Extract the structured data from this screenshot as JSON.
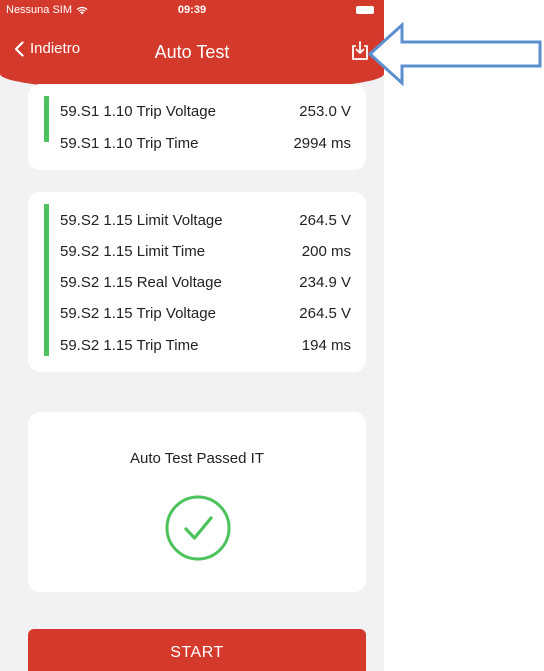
{
  "status_bar": {
    "carrier": "Nessuna SIM",
    "time": "09:39"
  },
  "nav": {
    "back_label": "Indietro",
    "title": "Auto Test"
  },
  "card1": {
    "rows": [
      {
        "label": "59.S1 1.10 Trip Voltage",
        "value": "253.0 V"
      },
      {
        "label": "59.S1 1.10 Trip Time",
        "value": "2994 ms"
      }
    ]
  },
  "card2": {
    "rows": [
      {
        "label": "59.S2 1.15 Limit Voltage",
        "value": "264.5 V"
      },
      {
        "label": "59.S2 1.15 Limit Time",
        "value": "200 ms"
      },
      {
        "label": "59.S2 1.15 Real Voltage",
        "value": "234.9 V"
      },
      {
        "label": "59.S2 1.15 Trip Voltage",
        "value": "264.5 V"
      },
      {
        "label": "59.S2 1.15 Trip Time",
        "value": "194 ms"
      }
    ]
  },
  "result": {
    "message": "Auto Test Passed IT"
  },
  "start_button": {
    "label": "START"
  },
  "colors": {
    "header_red": "#d43a2c",
    "status_green": "#4cc25c",
    "annotation_arrow": "#5b8fd0",
    "background": "#f2f2f4"
  },
  "icons": {
    "back": "chevron-left-icon",
    "download": "download-icon",
    "result": "check-circle-icon",
    "wifi": "wifi-icon",
    "battery": "battery-icon"
  }
}
